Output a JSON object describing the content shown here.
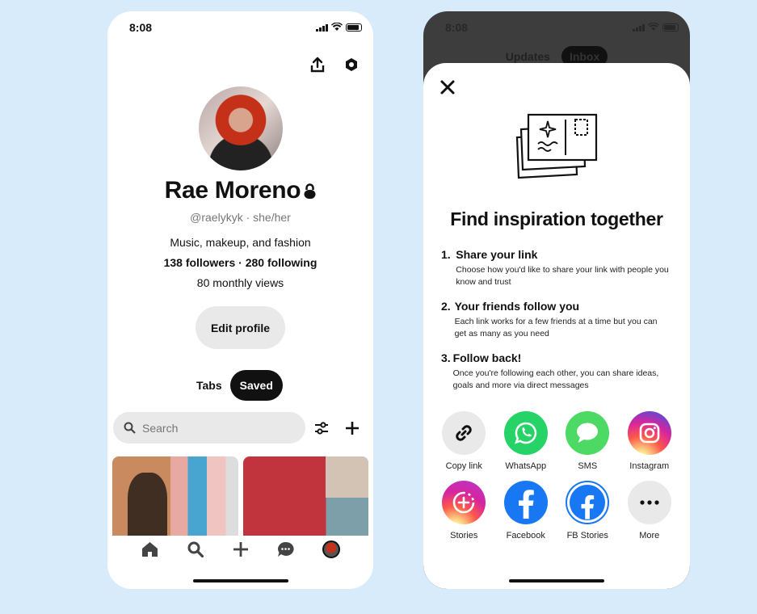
{
  "profile_screen": {
    "status": {
      "time": "8:08"
    },
    "name": "Rae Moreno",
    "handle": "@raelykyk · she/her",
    "bio": "Music, makeup, and fashion",
    "stats": "138 followers · 280 following",
    "views": "80 monthly views",
    "edit_button": "Edit profile",
    "tabs": {
      "tabs_label": "Tabs",
      "saved_label": "Saved"
    },
    "search": {
      "placeholder": "Search"
    },
    "nav_icons": [
      "home-icon",
      "search-icon",
      "plus-icon",
      "chat-icon",
      "profile-avatar"
    ]
  },
  "share_screen": {
    "status": {
      "time": "8:08"
    },
    "background_tabs": {
      "updates": "Updates",
      "inbox": "Inbox"
    },
    "headline": "Find inspiration together",
    "steps": [
      {
        "num": "1.",
        "title": "Share your link",
        "desc": "Choose how you'd like to share your link with people you know and trust"
      },
      {
        "num": "2.",
        "title": "Your friends follow you",
        "desc": "Each link works for a few friends at a time but you can get as many as you need"
      },
      {
        "num": "3.",
        "title": "Follow back!",
        "desc": "Once you're following each other, you can share ideas, goals and more via direct messages"
      }
    ],
    "share_options": [
      {
        "label": "Copy link",
        "icon": "link-icon",
        "color": "#e9e9e9"
      },
      {
        "label": "WhatsApp",
        "icon": "whatsapp-icon",
        "color": "#25d366"
      },
      {
        "label": "SMS",
        "icon": "sms-icon",
        "color": "#4cd964"
      },
      {
        "label": "Instagram",
        "icon": "instagram-icon",
        "color": "#d62976"
      },
      {
        "label": "Stories",
        "icon": "stories-icon",
        "color": "#d62976"
      },
      {
        "label": "Facebook",
        "icon": "facebook-icon",
        "color": "#1877f2"
      },
      {
        "label": "FB Stories",
        "icon": "fb-stories-icon",
        "color": "#1877f2"
      },
      {
        "label": "More",
        "icon": "more-icon",
        "color": "#e9e9e9"
      }
    ]
  }
}
